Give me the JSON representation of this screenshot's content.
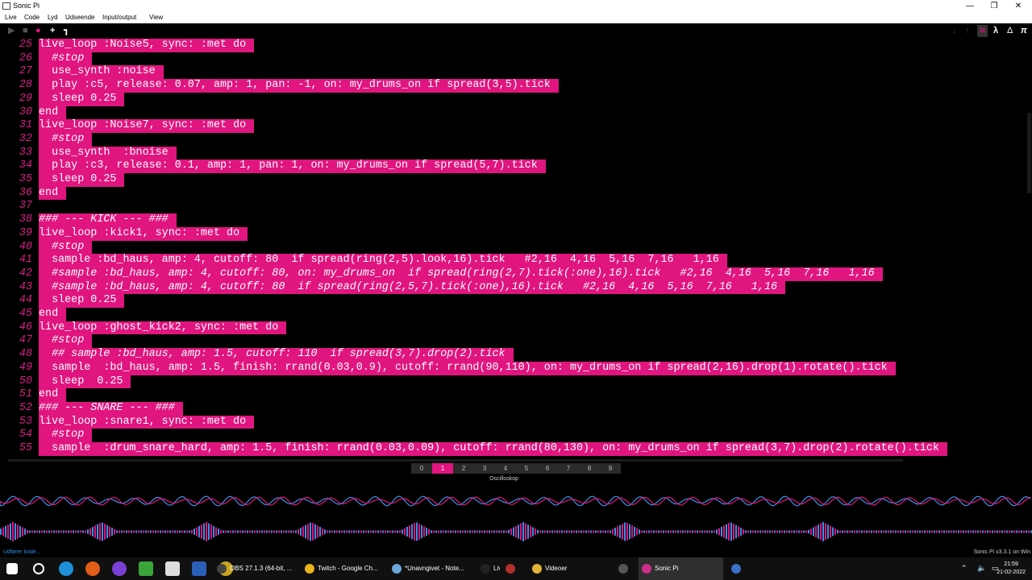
{
  "window": {
    "title": "Sonic Pi",
    "minimize": "—",
    "restore": "❐",
    "close": "✕"
  },
  "menu": [
    "Live",
    "Code",
    "Lyd",
    "Udseende",
    "Input/output",
    "View"
  ],
  "toolbar": {
    "run_icon": "▶",
    "stop_icon": "■",
    "record_icon": "●",
    "add_icon": "+",
    "corner_icon": "┓",
    "down_icon": "↓",
    "up_icon": "↑",
    "scope_icon": "≋",
    "lambda_icon": "λ",
    "delta_icon": "Δ",
    "pi_icon": "π"
  },
  "editor": {
    "lines": [
      {
        "n": "25",
        "text": "live_loop :Noise5, sync: :met do",
        "comment": false
      },
      {
        "n": "26",
        "text": "  #stop",
        "comment": true
      },
      {
        "n": "27",
        "text": "  use_synth :noise",
        "comment": false
      },
      {
        "n": "28",
        "text": "  play :c5, release: 0.07, amp: 1, pan: -1, on: my_drums_on if spread(3,5).tick",
        "comment": false
      },
      {
        "n": "29",
        "text": "  sleep 0.25",
        "comment": false
      },
      {
        "n": "30",
        "text": "end",
        "comment": false
      },
      {
        "n": "31",
        "text": "live_loop :Noise7, sync: :met do",
        "comment": false
      },
      {
        "n": "32",
        "text": "  #stop",
        "comment": true
      },
      {
        "n": "33",
        "text": "  use_synth  :bnoise",
        "comment": false
      },
      {
        "n": "34",
        "text": "  play :c3, release: 0.1, amp: 1, pan: 1, on: my_drums_on if spread(5,7).tick",
        "comment": false
      },
      {
        "n": "35",
        "text": "  sleep 0.25",
        "comment": false
      },
      {
        "n": "36",
        "text": "end",
        "comment": false
      },
      {
        "n": "37",
        "text": "",
        "comment": false
      },
      {
        "n": "38",
        "text": "### --- KICK --- ###",
        "comment": true
      },
      {
        "n": "39",
        "text": "live_loop :kick1, sync: :met do",
        "comment": false
      },
      {
        "n": "40",
        "text": "  #stop",
        "comment": true
      },
      {
        "n": "41",
        "text": "  sample :bd_haus, amp: 4, cutoff: 80  if spread(ring(2,5).look,16).tick   #2,16  4,16  5,16  7,16   1,16",
        "comment": false
      },
      {
        "n": "42",
        "text": "  #sample :bd_haus, amp: 4, cutoff: 80, on: my_drums_on  if spread(ring(2,7).tick(:one),16).tick   #2,16  4,16  5,16  7,16   1,16",
        "comment": true
      },
      {
        "n": "43",
        "text": "  #sample :bd_haus, amp: 4, cutoff: 80  if spread(ring(2,5,7).tick(:one),16).tick   #2,16  4,16  5,16  7,16   1,16",
        "comment": true
      },
      {
        "n": "44",
        "text": "  sleep 0.25",
        "comment": false
      },
      {
        "n": "45",
        "text": "end",
        "comment": false
      },
      {
        "n": "46",
        "text": "live_loop :ghost_kick2, sync: :met do",
        "comment": false
      },
      {
        "n": "47",
        "text": "  #stop",
        "comment": true
      },
      {
        "n": "48",
        "text": "  ## sample :bd_haus, amp: 1.5, cutoff: 110  if spread(3,7).drop(2).tick",
        "comment": true
      },
      {
        "n": "49",
        "text": "  sample  :bd_haus, amp: 1.5, finish: rrand(0.03,0.9), cutoff: rrand(90,110), on: my_drums_on if spread(2,16).drop(1).rotate().tick",
        "comment": false
      },
      {
        "n": "50",
        "text": "  sleep  0.25",
        "comment": false
      },
      {
        "n": "51",
        "text": "end",
        "comment": false
      },
      {
        "n": "52",
        "text": "### --- SNARE --- ###",
        "comment": true
      },
      {
        "n": "53",
        "text": "live_loop :snare1, sync: :met do",
        "comment": false
      },
      {
        "n": "54",
        "text": "  #stop",
        "comment": true
      },
      {
        "n": "55",
        "text": "  sample  :drum_snare_hard, amp: 1.5, finish: rrand(0.03,0.09), cutoff: rrand(80,130), on: my_drums_on if spread(3,7).drop(2).rotate().tick",
        "comment": false
      }
    ]
  },
  "buffers": {
    "tabs": [
      "0",
      "1",
      "2",
      "3",
      "4",
      "5",
      "6",
      "7",
      "8",
      "9"
    ],
    "active_index": 1
  },
  "scope": {
    "title": "Oscilloskop"
  },
  "status": {
    "left": "Udfører kode...",
    "right": "Sonic Pi v3.3.1 on Win"
  },
  "taskbar": {
    "tasks": [
      {
        "label": "OBS 27.1.3 (64-bit, ...",
        "color": "#444444"
      },
      {
        "label": "Twitch - Google Ch...",
        "color": "#e8b41c"
      },
      {
        "label": "*Unavngivet - Note...",
        "color": "#6aa6d8"
      },
      {
        "label": "Live",
        "color": "#222222"
      },
      {
        "label": "",
        "color": "#b0302a"
      },
      {
        "label": "Videoer",
        "color": "#e3b43a"
      },
      {
        "label": "",
        "color": "#555555"
      },
      {
        "label": "Sonic Pi",
        "color": "#cc2e8c"
      },
      {
        "label": "",
        "color": "#3a72c4"
      }
    ],
    "clock_time": "21:59",
    "clock_date": "21-02-2022"
  },
  "colors": {
    "highlight": "#e0157f",
    "line_number": "#d81f83",
    "scope_blue": "#3f8fe6"
  }
}
